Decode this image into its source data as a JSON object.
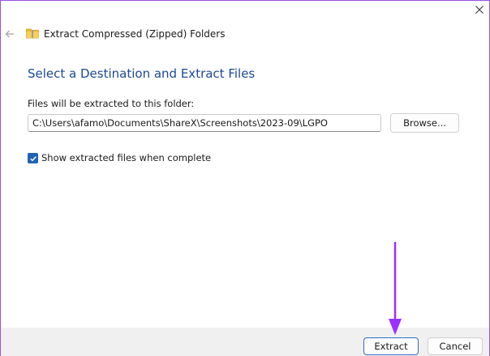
{
  "window": {
    "title": "Extract Compressed (Zipped) Folders",
    "close_glyph": "✕",
    "back_glyph": "←",
    "accent_color": "#1f63b7"
  },
  "content": {
    "heading": "Select a Destination and Extract Files",
    "destination_label": "Files will be extracted to this folder:",
    "destination_path": "C:\\Users\\afamo\\Documents\\ShareX\\Screenshots\\2023-09\\LGPO",
    "browse_label": "Browse...",
    "show_files_label": "Show extracted files when complete",
    "show_files_checked": true
  },
  "footer": {
    "extract_label": "Extract",
    "cancel_label": "Cancel"
  },
  "annotation": {
    "arrow_color": "#9b30ff"
  }
}
